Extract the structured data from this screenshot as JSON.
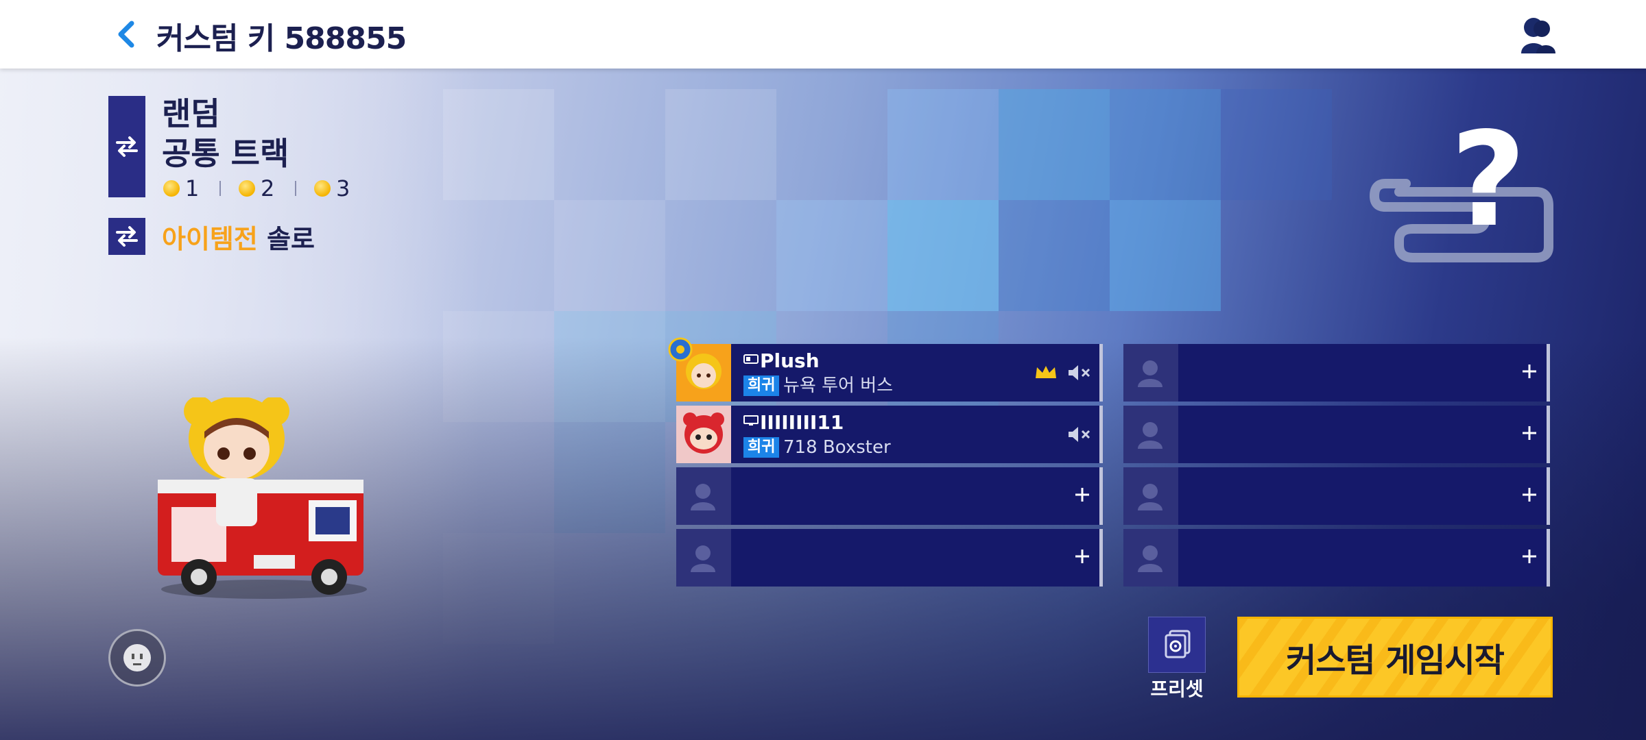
{
  "header": {
    "room_title": "커스텀 키 588855",
    "back_icon": "chevron-left-icon",
    "profile_icon": "profile-icon"
  },
  "track": {
    "name_line1": "랜덤",
    "name_line2": "공통 트랙",
    "coins": [
      "1",
      "2",
      "3"
    ],
    "swap_icon": "swap-icon"
  },
  "mode": {
    "highlight": "아이템전",
    "suffix": "솔로",
    "swap_icon": "swap-icon"
  },
  "slots": {
    "left": [
      {
        "type": "player",
        "name": "Plush",
        "rarity": "희귀",
        "kart": "뉴욕 투어 버스",
        "host": true,
        "device": "controller-icon"
      },
      {
        "type": "player",
        "name": "IIIIIIII11",
        "rarity": "희귀",
        "kart": "718 Boxster",
        "host": false,
        "device": "monitor-icon"
      },
      {
        "type": "empty"
      },
      {
        "type": "empty"
      }
    ],
    "right": [
      {
        "type": "empty"
      },
      {
        "type": "empty"
      },
      {
        "type": "empty"
      },
      {
        "type": "empty"
      }
    ]
  },
  "actions": {
    "preset_label": "프리셋",
    "start_label": "커스텀 게임시작"
  },
  "colors": {
    "accent_orange": "#f7a21b",
    "navy": "#2a2d86",
    "start_yellow": "#fcc726",
    "rarity_blue": "#1c84e8"
  }
}
